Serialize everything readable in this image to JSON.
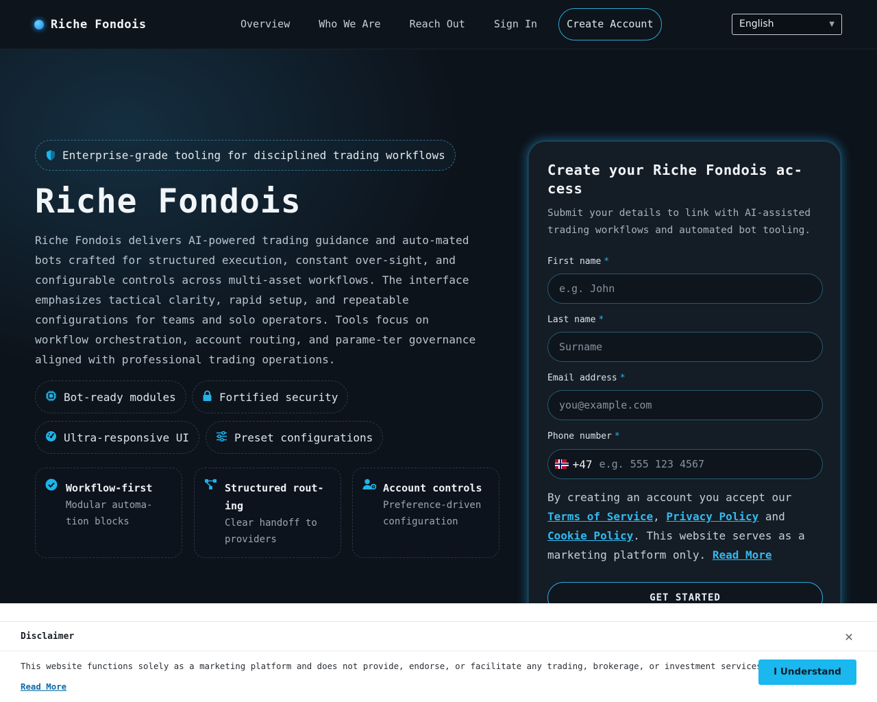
{
  "header": {
    "brand": "Riche Fondois",
    "nav": [
      "Overview",
      "Who We Are",
      "Reach Out",
      "Sign In"
    ],
    "cta": "Create Account",
    "language": "English"
  },
  "hero": {
    "tagline": "Enterprise-grade tooling for disciplined trading workflows",
    "title": "Riche Fondois",
    "description": "Riche Fondois delivers AI-powered trading guidance and auto-mated bots crafted for structured execution, constant over-sight, and configurable controls across multi-asset workflows. The interface emphasizes tactical clarity, rapid setup, and repeatable configurations for teams and solo operators. Tools focus on workflow orchestration, account routing, and parame-ter governance aligned with professional trading operations.",
    "pills": [
      {
        "label": "Bot-ready modules",
        "icon": "chip-icon"
      },
      {
        "label": "Fortified security",
        "icon": "lock-icon"
      },
      {
        "label": "Ultra-responsive UI",
        "icon": "gauge-icon"
      },
      {
        "label": "Preset configurations",
        "icon": "sliders-icon"
      }
    ],
    "cards": [
      {
        "title": "Workflow-first",
        "sub": "Modular automa-tion blocks",
        "icon": "check-circle-icon"
      },
      {
        "title": "Structured rout-ing",
        "sub": "Clear handoff to providers",
        "icon": "route-icon"
      },
      {
        "title": "Account controls",
        "sub": "Preference-driven configuration",
        "icon": "user-gear-icon"
      }
    ]
  },
  "form": {
    "title": "Create your Riche Fondois ac-cess",
    "subtitle": "Submit your details to link with AI-assisted trading workflows and automated bot tooling.",
    "first_name": {
      "label": "First name",
      "placeholder": "e.g. John"
    },
    "last_name": {
      "label": "Last name",
      "placeholder": "Surname"
    },
    "email": {
      "label": "Email address",
      "placeholder": "you@example.com"
    },
    "phone": {
      "label": "Phone number",
      "dial_code": "+47",
      "placeholder": "e.g. 555 123 4567"
    },
    "required_mark": "*",
    "consent": {
      "prefix": "By creating an account you accept our",
      "terms": "Terms of Service",
      "comma": ",",
      "privacy": "Privacy Policy",
      "and": "and",
      "cookie": "Cookie Policy",
      "suffix": ". This website serves as a marketing platform only.",
      "read_more": "Read More"
    },
    "submit": "GET STARTED"
  },
  "disclaimer": {
    "title": "Disclaimer",
    "text": "This website functions solely as a marketing platform and does not provide, endorse, or facilitate any trading, brokerage, or investment services.",
    "read_more": "Read More",
    "button": "I Understand"
  },
  "colors": {
    "accent": "#1ab8ee",
    "background": "#0d131b",
    "panel": "#141c25"
  }
}
